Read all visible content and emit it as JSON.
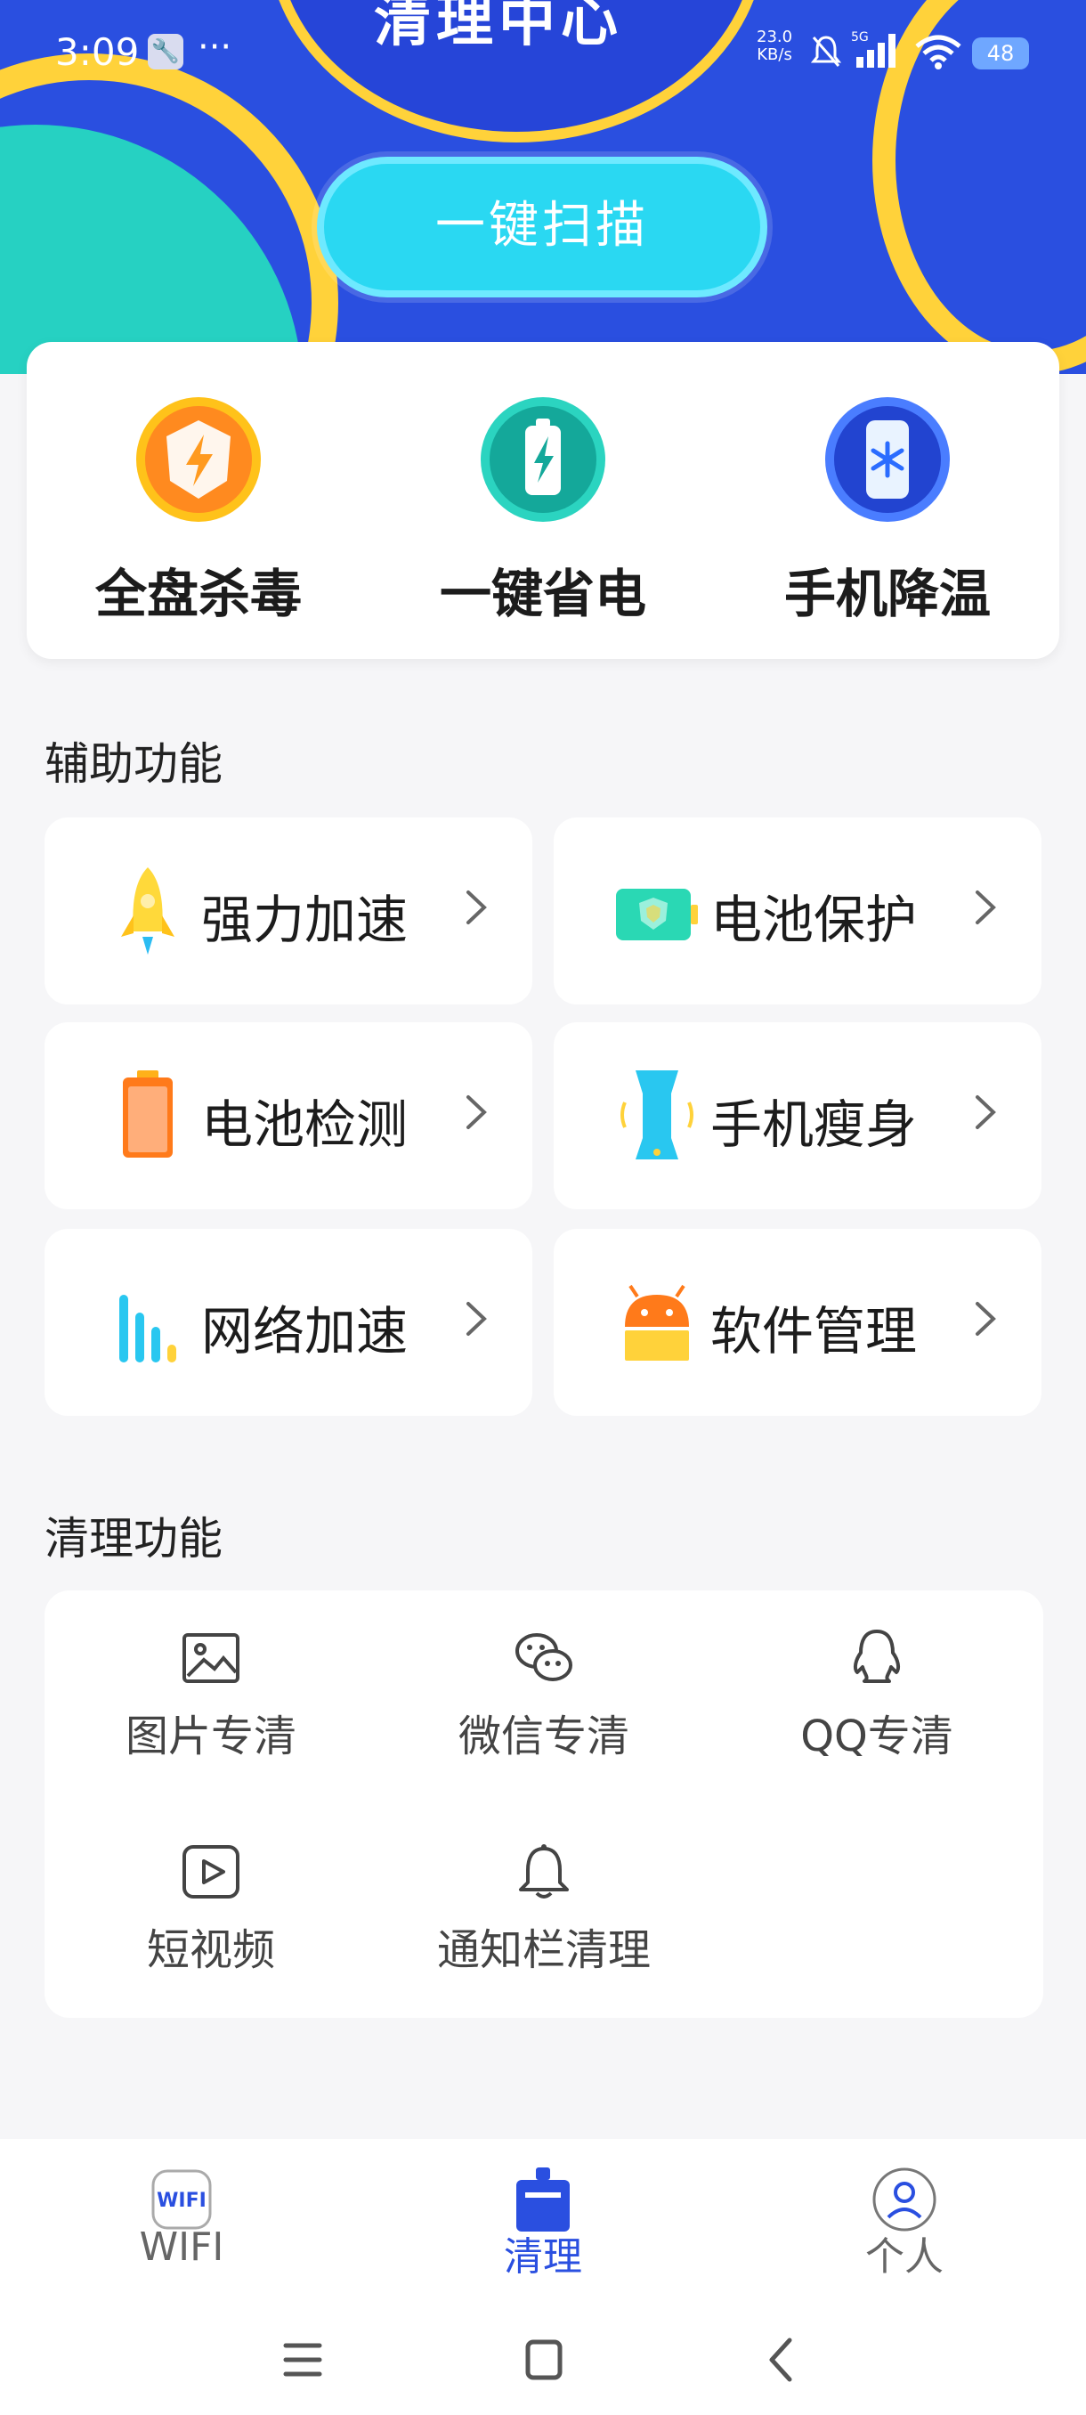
{
  "status_bar": {
    "time": "3:09",
    "dots": "···",
    "speed_value": "23.0",
    "speed_unit": "KB/s",
    "battery": "48"
  },
  "hero": {
    "partial_title": "清理中心",
    "scan_button": "一键扫描"
  },
  "features": [
    {
      "label": "全盘杀毒",
      "icon": "shield-bolt-icon"
    },
    {
      "label": "一键省电",
      "icon": "battery-bolt-icon"
    },
    {
      "label": "手机降温",
      "icon": "phone-snowflake-icon"
    }
  ],
  "aux_section": {
    "title": "辅助功能",
    "items": [
      {
        "label": "强力加速",
        "icon": "rocket-icon"
      },
      {
        "label": "电池保护",
        "icon": "battery-shield-icon"
      },
      {
        "label": "电池检测",
        "icon": "battery-check-icon"
      },
      {
        "label": "手机瘦身",
        "icon": "phone-slim-icon"
      },
      {
        "label": "网络加速",
        "icon": "bars-icon"
      },
      {
        "label": "软件管理",
        "icon": "android-icon"
      }
    ]
  },
  "clean_section": {
    "title": "清理功能",
    "items": [
      {
        "label": "图片专清",
        "icon": "image-icon"
      },
      {
        "label": "微信专清",
        "icon": "wechat-icon"
      },
      {
        "label": "QQ专清",
        "icon": "qq-icon"
      },
      {
        "label": "短视频",
        "icon": "video-icon"
      },
      {
        "label": "通知栏清理",
        "icon": "bell-icon"
      }
    ]
  },
  "tabbar": {
    "tabs": [
      {
        "label": "WIFI",
        "icon_text": "WIFI",
        "active": false
      },
      {
        "label": "清理",
        "active": true
      },
      {
        "label": "个人",
        "active": false
      }
    ]
  },
  "colors": {
    "hero_blue": "#2a4fe0",
    "accent_yellow": "#ffd23a",
    "scan_button": "#2ad8f2",
    "tab_active": "#2a4fe0",
    "tab_inactive": "#666666"
  }
}
